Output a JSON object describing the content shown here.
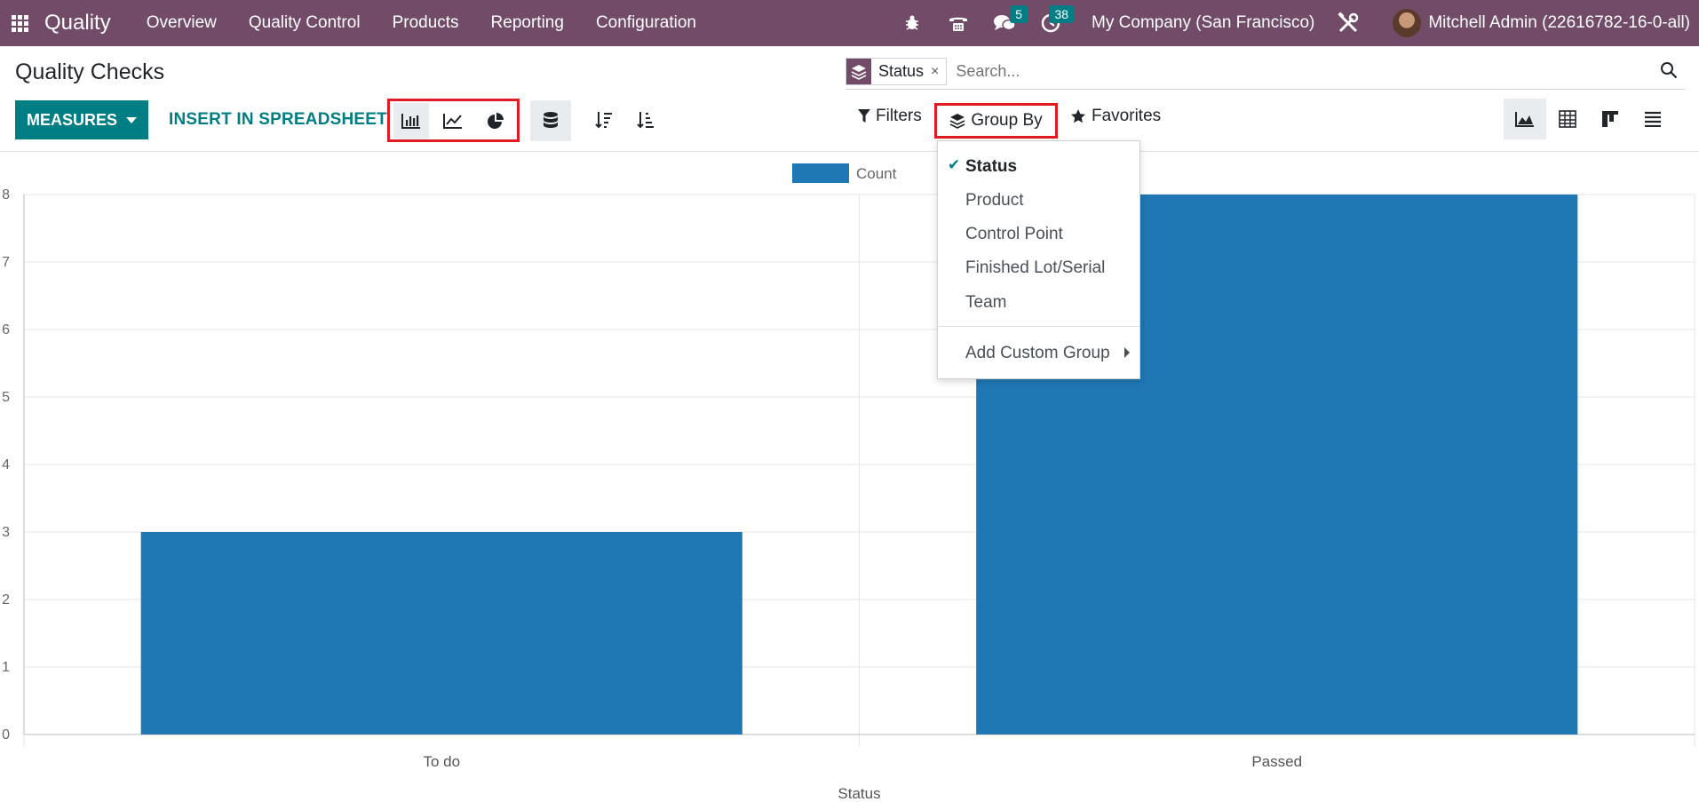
{
  "navbar": {
    "brand": "Quality",
    "menu": [
      "Overview",
      "Quality Control",
      "Products",
      "Reporting",
      "Configuration"
    ],
    "messages_count": "5",
    "activities_count": "38",
    "company": "My Company (San Francisco)",
    "user": "Mitchell Admin (22616782-16-0-all)",
    "color": "#714B67"
  },
  "page": {
    "title": "Quality Checks",
    "measures_label": "MEASURES",
    "insert_label": "INSERT IN SPREADSHEET"
  },
  "search": {
    "facet_value": "Status",
    "facet_close": "×",
    "placeholder": "Search..."
  },
  "filter_bar": {
    "filters_label": "Filters",
    "groupby_label": "Group By",
    "favorites_label": "Favorites"
  },
  "groupby_menu": {
    "items": [
      {
        "label": "Status",
        "selected": true
      },
      {
        "label": "Product",
        "selected": false
      },
      {
        "label": "Control Point",
        "selected": false
      },
      {
        "label": "Finished Lot/Serial",
        "selected": false
      },
      {
        "label": "Team",
        "selected": false
      }
    ],
    "custom_group_label": "Add Custom Group",
    "check_glyph": "✔"
  },
  "chart_data": {
    "type": "bar",
    "categories": [
      "To do",
      "Passed"
    ],
    "series": [
      {
        "name": "Count",
        "values": [
          3,
          8
        ],
        "color": "#1f77b4"
      }
    ],
    "xlabel": "Status",
    "ylabel": "",
    "ylim": [
      0,
      8
    ],
    "yticks": [
      "0",
      "1",
      "2",
      "3",
      "4",
      "5",
      "6",
      "7",
      "8"
    ],
    "legend_position": "top-center",
    "grid": true
  },
  "colors": {
    "accent": "#017e84",
    "highlight_box": "#e01b24",
    "bar": "#1f77b4"
  }
}
